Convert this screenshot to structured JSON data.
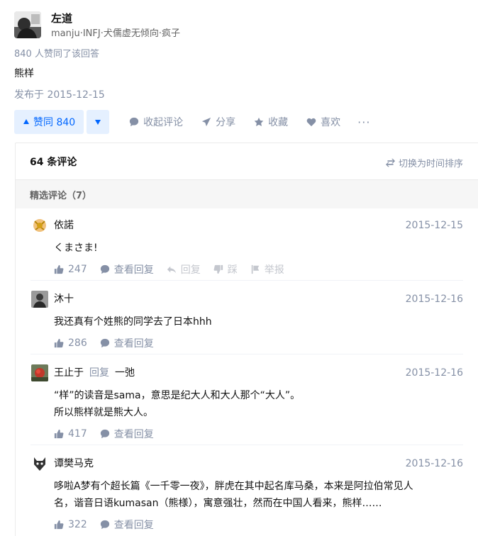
{
  "answer": {
    "author": {
      "name": "左道",
      "bio": "manju·INFJ·犬儒虚无倾向·疯子"
    },
    "vote_summary": "840 人赞同了该回答",
    "content": "熊样",
    "published": "发布于 2015-12-15",
    "actions": {
      "upvote_label": "赞同 840",
      "collapse_comments": "收起评论",
      "share": "分享",
      "collect": "收藏",
      "like": "喜欢"
    }
  },
  "comments": {
    "count_label": "64 条评论",
    "sort_label": "切换为时间排序",
    "featured_label": "精选评论（7）",
    "items": [
      {
        "author": "依諾",
        "date": "2015-12-15",
        "body": [
          "くまさま!"
        ],
        "likes": "247",
        "view_replies": "查看回复",
        "reply": "回复",
        "dislike": "踩",
        "report": "举报"
      },
      {
        "author": "沐十",
        "date": "2015-12-16",
        "body": [
          "我还真有个姓熊的同学去了日本hhh"
        ],
        "likes": "286",
        "view_replies": "查看回复"
      },
      {
        "author": "王止于",
        "reply_word": "回复",
        "reply_to": "一弛",
        "date": "2015-12-16",
        "body": [
          "“样”的读音是sama，意思是纪大人和大人那个“大人”。",
          "所以熊样就是熊大人。"
        ],
        "likes": "417",
        "view_replies": "查看回复"
      },
      {
        "author": "谭樊马克",
        "date": "2015-12-16",
        "body": [
          "哆啦A梦有个超长篇《一千零一夜》，胖虎在其中起名库马桑，本来是阿拉伯常见人",
          "名，谐音日语kumasan（熊様），寓意强壮，然而在中国人看来，熊样……"
        ],
        "likes": "322",
        "view_replies": "查看回复"
      }
    ]
  }
}
